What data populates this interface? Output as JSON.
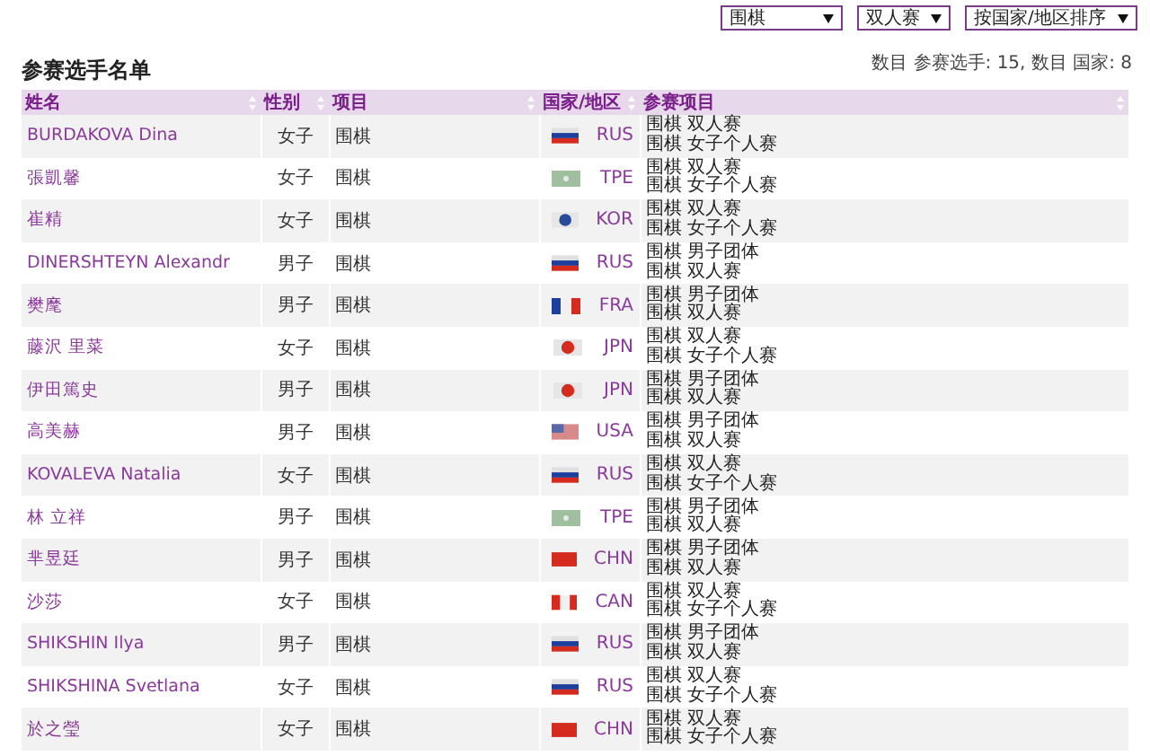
{
  "filters": [
    {
      "value": "围棋"
    },
    {
      "value": "双人赛"
    },
    {
      "value": "按国家/地区排序"
    }
  ],
  "title": "参赛选手名单",
  "summary": "数目 参赛选手: 15, 数目 国家: 8",
  "table": {
    "columns": [
      "姓名",
      "性别",
      "项目",
      "国家/地区",
      "参赛项目"
    ],
    "rows": [
      {
        "name": "BURDAKOVA Dina",
        "gender": "女子",
        "sport": "围棋",
        "flag": {
          "kind": "h-stripes",
          "color": "#1c3f9e"
        },
        "country": "RUS",
        "events": [
          "围棋 双人赛",
          "围棋 女子个人赛"
        ]
      },
      {
        "name": "張凱馨",
        "gender": "女子",
        "sport": "围棋",
        "flag": {
          "kind": "plain",
          "color": "#9fbf9f"
        },
        "country": "TPE",
        "events": [
          "围棋 双人赛",
          "围棋 女子个人赛"
        ]
      },
      {
        "name": "崔精",
        "gender": "女子",
        "sport": "围棋",
        "flag": {
          "kind": "disc",
          "color": "#2a4a9a"
        },
        "country": "KOR",
        "events": [
          "围棋 双人赛",
          "围棋 女子个人赛"
        ]
      },
      {
        "name": "DINERSHTEYN Alexandr",
        "gender": "男子",
        "sport": "围棋",
        "flag": {
          "kind": "h-stripes",
          "color": "#1c3f9e"
        },
        "country": "RUS",
        "events": [
          "围棋 男子团体",
          "围棋 双人赛"
        ]
      },
      {
        "name": "樊麾",
        "gender": "男子",
        "sport": "围棋",
        "flag": {
          "kind": "v-stripes",
          "color": "#1c3f9e"
        },
        "country": "FRA",
        "events": [
          "围棋 男子团体",
          "围棋 双人赛"
        ]
      },
      {
        "name": "藤沢 里菜",
        "gender": "女子",
        "sport": "围棋",
        "flag": {
          "kind": "disc",
          "color": "#d52b1e"
        },
        "country": "JPN",
        "events": [
          "围棋 双人赛",
          "围棋 女子个人赛"
        ]
      },
      {
        "name": "伊田篤史",
        "gender": "男子",
        "sport": "围棋",
        "flag": {
          "kind": "disc",
          "color": "#d52b1e"
        },
        "country": "JPN",
        "events": [
          "围棋 男子团体",
          "围棋 双人赛"
        ]
      },
      {
        "name": "高美赫",
        "gender": "男子",
        "sport": "围棋",
        "flag": {
          "kind": "canton",
          "color": "#d88a8a"
        },
        "country": "USA",
        "events": [
          "围棋 男子团体",
          "围棋 双人赛"
        ]
      },
      {
        "name": "KOVALEVA Natalia",
        "gender": "女子",
        "sport": "围棋",
        "flag": {
          "kind": "h-stripes",
          "color": "#1c3f9e"
        },
        "country": "RUS",
        "events": [
          "围棋 双人赛",
          "围棋 女子个人赛"
        ]
      },
      {
        "name": "林 立祥",
        "gender": "男子",
        "sport": "围棋",
        "flag": {
          "kind": "plain",
          "color": "#9fbf9f"
        },
        "country": "TPE",
        "events": [
          "围棋 男子团体",
          "围棋 双人赛"
        ]
      },
      {
        "name": "芈昱廷",
        "gender": "男子",
        "sport": "围棋",
        "flag": {
          "kind": "solid",
          "color": "#d52b1e"
        },
        "country": "CHN",
        "events": [
          "围棋 男子团体",
          "围棋 双人赛"
        ]
      },
      {
        "name": "沙莎",
        "gender": "女子",
        "sport": "围棋",
        "flag": {
          "kind": "v-stripes",
          "color": "#d52b1e"
        },
        "country": "CAN",
        "events": [
          "围棋 双人赛",
          "围棋 女子个人赛"
        ]
      },
      {
        "name": "SHIKSHIN Ilya",
        "gender": "男子",
        "sport": "围棋",
        "flag": {
          "kind": "h-stripes",
          "color": "#1c3f9e"
        },
        "country": "RUS",
        "events": [
          "围棋 男子团体",
          "围棋 双人赛"
        ]
      },
      {
        "name": "SHIKSHINA Svetlana",
        "gender": "女子",
        "sport": "围棋",
        "flag": {
          "kind": "h-stripes",
          "color": "#1c3f9e"
        },
        "country": "RUS",
        "events": [
          "围棋 双人赛",
          "围棋 女子个人赛"
        ]
      },
      {
        "name": "於之瑩",
        "gender": "女子",
        "sport": "围棋",
        "flag": {
          "kind": "solid",
          "color": "#d52b1e"
        },
        "country": "CHN",
        "events": [
          "围棋 双人赛",
          "围棋 女子个人赛"
        ]
      }
    ]
  }
}
